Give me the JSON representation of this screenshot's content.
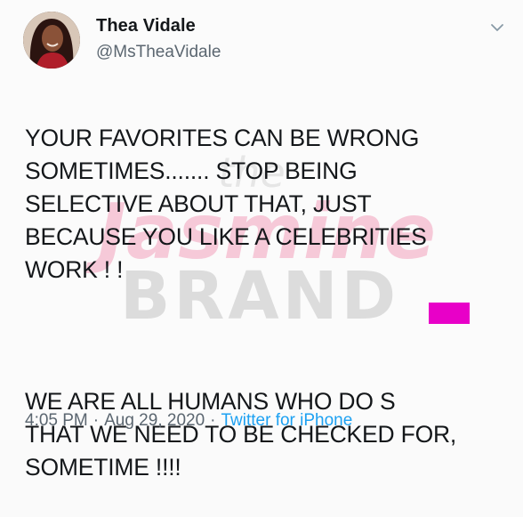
{
  "author": {
    "display_name": "Thea Vidale",
    "handle": "@MsTheaVidale"
  },
  "tweet": {
    "paragraph_1": "YOUR FAVORITES CAN BE WRONG\nSOMETIMES....... STOP BEING\nSELECTIVE ABOUT THAT, JUST\nBECAUSE YOU LIKE A CELEBRITIES\nWORK ! !",
    "paragraph_2": "WE ARE ALL HUMANS WHO DO S\nTHAT WE NEED TO BE CHECKED FOR,\nSOMETIME !!!!"
  },
  "meta": {
    "time": "4:05 PM",
    "separator": "·",
    "date": "Aug 29, 2020",
    "source": "Twitter for iPhone"
  },
  "watermark": {
    "line_1": "the",
    "line_2": "Jasmine",
    "line_3": "BRAND"
  },
  "icons": {
    "caret": "chevron-down-icon"
  },
  "colors": {
    "link": "#1da1f2",
    "secondary_text": "#5b6670",
    "redaction": "#e800c8",
    "watermark_pink": "#f6c9d8",
    "watermark_gray": "#dcdcdc"
  }
}
